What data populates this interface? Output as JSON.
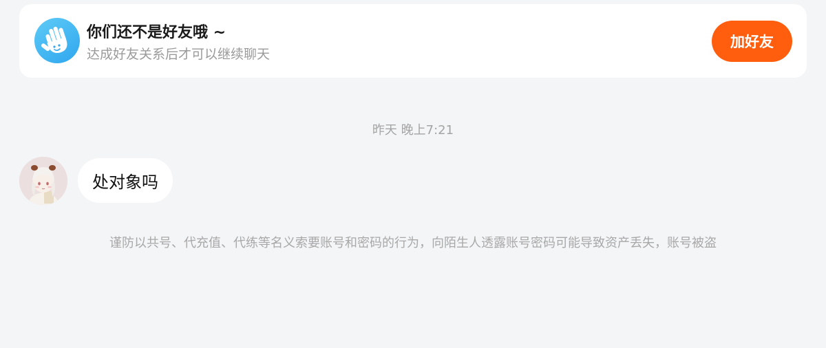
{
  "banner": {
    "title": "你们还不是好友哦 ~",
    "subtitle": "达成好友关系后才可以继续聊天",
    "add_friend_label": "加好友",
    "icon": "waving-hand-icon",
    "icon_color": "#3ab3f2",
    "button_color": "#ff5e0e"
  },
  "chat": {
    "timestamp": "昨天 晚上7:21",
    "messages": [
      {
        "sender_avatar": "avatar-anime-girl",
        "text": "处对象吗"
      }
    ]
  },
  "notice": {
    "text": "谨防以共号、代充值、代练等名义索要账号和密码的行为，向陌生人透露账号密码可能导致资产丢失，账号被盗"
  }
}
